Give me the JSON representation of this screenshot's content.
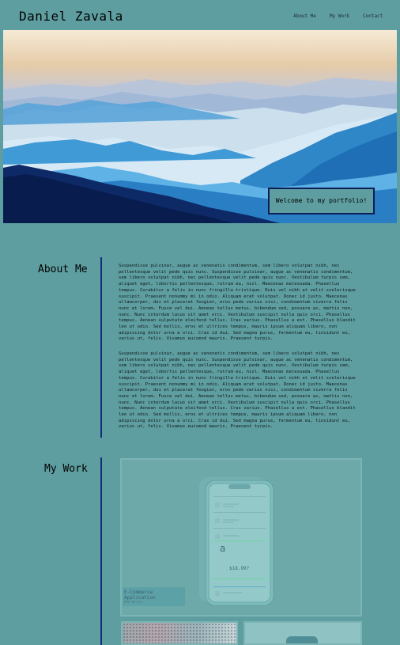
{
  "header": {
    "site_name": "Daniel Zavala",
    "nav": [
      "About Me",
      "My Work",
      "Contact"
    ]
  },
  "hero": {
    "welcome_text": "Welcome to my portfolio!"
  },
  "about": {
    "title": "About Me",
    "paragraphs": [
      "Suspendisse pulvinar, augue ac venenatis condimentum, sem libero volutpat nibh, nec pellentesque velit pede quis nunc. Suspendisse pulvinar, augue ac venenatis condimentum, sem libero volutpat nibh, nec pellentesque velit pede quis nunc. Vestibulum turpis sem, aliquet eget, lobortis pellentesque, rutrum eu, nisl. Maecenas malesuada. Phasellus tempus. Curabitur a felis in nunc fringilla tristique. Duis vel nibh at velit scelerisque suscipit. Praesent nonummy mi in odio. Aliquam erat volutpat. Donec id justo. Maecenas ullamcorper, dui et placerat feugiat, eros pede varius nisi, condimentum viverra felis nunc et lorem. Fusce vel dui. Aenean tellus metus, bibendum sed, posuere ac, mattis non, nunc. Nunc interdum lacus sit amet orci. Vestibulum suscipit nulla quis orci. Phasellus tempus. Aenean vulputate eleifend tellus. Cras varius. Phasellus a est. Phasellus blandit leo ut odio. Sed mollis, eros et ultrices tempus, mauris ipsum aliquam libero, non adipiscing dolor urna a orci. Cras id dui. Sed magna purus, fermentum eu, tincidunt eu, varius ut, felis. Vivamus euismod mauris. Praesent turpis.",
      "Suspendisse pulvinar, augue ac venenatis condimentum, sem libero volutpat nibh, nec pellentesque velit pede quis nunc. Suspendisse pulvinar, augue ac venenatis condimentum, sem libero volutpat nibh, nec pellentesque velit pede quis nunc. Vestibulum turpis sem, aliquet eget, lobortis pellentesque, rutrum eu, nisl. Maecenas malesuada. Phasellus tempus. Curabitur a felis in nunc fringilla tristique. Duis vel nibh at velit scelerisque suscipit. Praesent nonummy mi in odio. Aliquam erat volutpat. Donec id justo. Maecenas ullamcorper, dui et placerat feugiat, eros pede varius nisi, condimentum viverra felis nunc et lorem. Fusce vel dui. Aenean tellus metus, bibendum sed, posuere ac, mattis non, nunc. Nunc interdum lacus sit amet orci. Vestibulum suscipit nulla quis orci. Phasellus tempus. Aenean vulputate eleifend tellus. Cras varius. Phasellus a est. Phasellus blandit leo ut odio. Sed mollis, eros et ultrices tempus, mauris ipsum aliquam libero, non adipiscing dolor urna a orci. Cras id dui. Sed magna purus, fermentum eu, tincidunt eu, varius ut, felis. Vivamus euismod mauris. Praesent turpis."
    ]
  },
  "work": {
    "title": "My Work",
    "featured": {
      "title": "E-Commerce Application",
      "subtitle": "Web Build",
      "phone_price": "$18.99?",
      "phone_letter": "a"
    }
  },
  "colors": {
    "page_background": "#5f9ea0",
    "divider": "#10307a",
    "welcome_border": "#0b1e58"
  },
  "icons": [
    "mountain-landscape-image",
    "phone-mockup-image"
  ]
}
